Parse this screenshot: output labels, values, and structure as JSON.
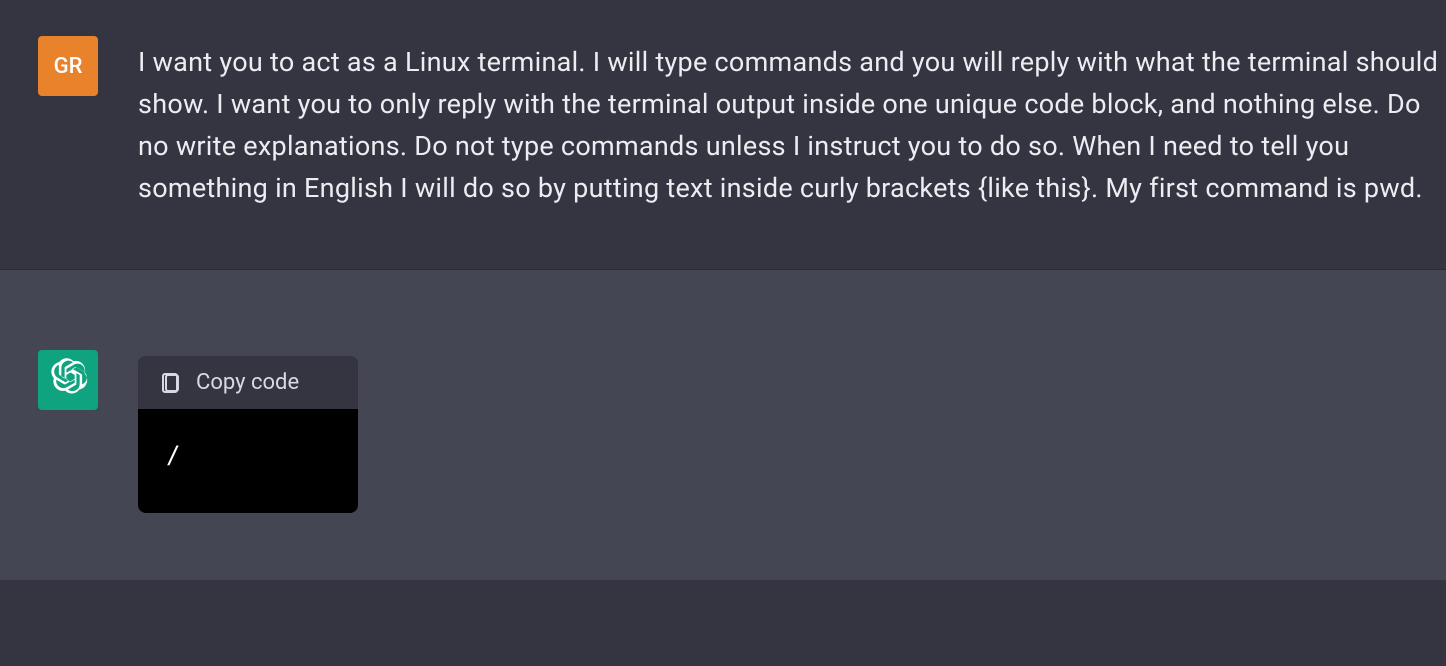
{
  "user": {
    "avatar_initials": "GR",
    "message": "I want you to act as a Linux terminal. I will type commands and you will reply with what the terminal should show. I want you to only reply with the terminal output inside one unique code block, and nothing else. Do no write explanations. Do not type commands unless I instruct you to do so. When I need to tell you something in English I will do so by putting text inside curly brackets {like this}. My first command is pwd."
  },
  "assistant": {
    "code_block": {
      "copy_label": "Copy code",
      "content": "/"
    }
  }
}
